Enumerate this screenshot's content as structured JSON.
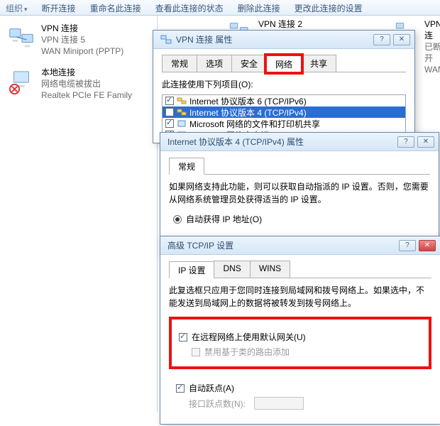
{
  "toolbar": {
    "items": [
      "组织",
      "断开连接",
      "重命名此连接",
      "查看此连接的状态",
      "删除此连接",
      "更改此连接的设置"
    ]
  },
  "left_panel": {
    "items": [
      {
        "title": "VPN 连接",
        "sub1": "VPN 连接 5",
        "sub2": "WAN Miniport (PPTP)",
        "icon": "vpn"
      },
      {
        "title": "本地连接",
        "sub1": "网络电缆被拔出",
        "sub2": "Realtek PCIe FE Family",
        "icon": "local-x"
      }
    ]
  },
  "right_hints": [
    {
      "title": "VPN 连接 2"
    },
    {
      "title": "VPN 连",
      "sub1": "已断开",
      "sub2": "WAN"
    }
  ],
  "dlg_vpn": {
    "title": "VPN 连接 属性",
    "tabs": [
      "常规",
      "选项",
      "安全",
      "网络",
      "共享"
    ],
    "active_tab": 3,
    "section_label": "此连接使用下列项目(O):",
    "items": [
      {
        "checked": true,
        "label": "Internet 协议版本 6 (TCP/IPv6)",
        "sel": false
      },
      {
        "checked": true,
        "label": "Internet 协议版本 4 (TCP/IPv4)",
        "sel": true
      },
      {
        "checked": true,
        "label": "Microsoft 网络的文件和打印机共享",
        "sel": false
      },
      {
        "checked": true,
        "label": "Microsoft 网络客户端",
        "sel": false
      }
    ]
  },
  "dlg_ipv4": {
    "title": "Internet 协议版本 4 (TCP/IPv4) 属性",
    "tabs": [
      "常规"
    ],
    "desc": "如果网络支持此功能，则可以获取自动指派的 IP 设置。否则，您需要从网络系统管理员处获得适当的 IP 设置。",
    "radio_label": "自动获得 IP 地址(O)"
  },
  "dlg_adv": {
    "title": "高级 TCP/IP 设置",
    "tabs": [
      "IP 设置",
      "DNS",
      "WINS"
    ],
    "desc": "此复选框只应用于您同时连接到局域网和拨号网络上。如果选中，不能发送到局域网上的数据将被转发到拨号网络上。",
    "group1": {
      "chk1": "在远程网络上使用默认网关(U)",
      "chk2": "禁用基于类的路由添加"
    },
    "group2": {
      "chk": "自动跃点(A)",
      "metric_label": "接口跃点数(N):"
    }
  }
}
